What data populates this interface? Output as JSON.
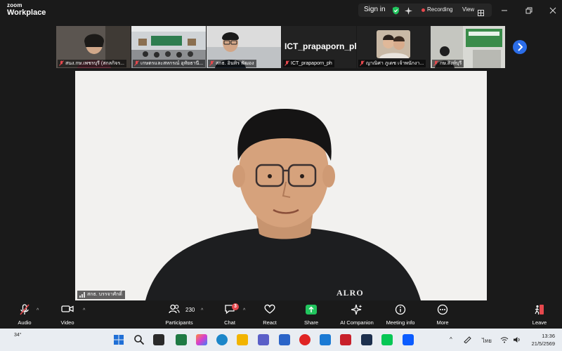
{
  "app": {
    "brand_top": "zoom",
    "brand_bottom": "Workplace"
  },
  "titlebar": {
    "signin": "Sign in",
    "recording": "Recording",
    "view": "View"
  },
  "participants_strip": [
    {
      "name": "สนง.กษ.เพชรบุรี (สกลกิจร..."
    },
    {
      "name": "เกษตรและสหกรณ์ อุทัยธานี..."
    },
    {
      "name": "สกธ. อินทิร พัฒอง"
    },
    {
      "name": "ICT_prapaporn_ph",
      "big_name": "ICT_prapaporn_ph"
    },
    {
      "name": "ญาณิศา ภูเดช เจ้าพนักงา..."
    },
    {
      "name": "กษ.สิงห์บุรี"
    }
  ],
  "main_video": {
    "speaker_label": "สกธ. บรรจาศักดิ์",
    "shirt_text": "ALRO"
  },
  "toolbar": {
    "audio": "Audio",
    "video": "Video",
    "participants": "Participants",
    "participants_count": "230",
    "chat": "Chat",
    "chat_badge": "3",
    "react": "React",
    "share": "Share",
    "ai_companion": "AI Companion",
    "meeting_info": "Meeting info",
    "more": "More",
    "leave": "Leave"
  },
  "taskbar": {
    "weather": "34°",
    "language": "ไทย",
    "time": "13:36",
    "date": "21/5/2569"
  },
  "colors": {
    "accent_blue": "#2b6de8",
    "share_green": "#22c55e",
    "alert_red": "#e5484d"
  }
}
